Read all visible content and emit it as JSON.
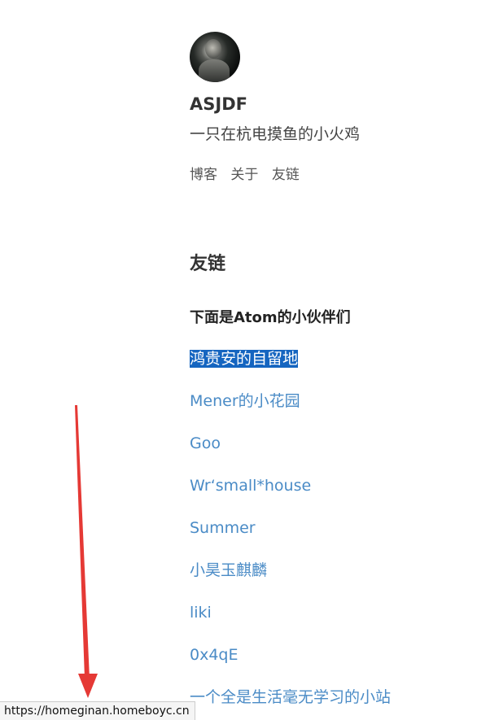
{
  "profile": {
    "name": "ASJDF",
    "tagline": "一只在杭电摸鱼的小火鸡"
  },
  "nav": {
    "items": [
      "博客",
      "关于",
      "友链"
    ]
  },
  "page": {
    "title": "友链",
    "intro": "下面是Atom的小伙伴们"
  },
  "links": [
    "鸿贵安的自留地",
    "Mener的小花园",
    "Goo",
    "Wr‘small*house",
    "Summer",
    "小昊玉麒麟",
    "liki",
    "0x4qE",
    "一个全是生活毫无学习的小站"
  ],
  "status_bar": {
    "url": "https://homeginan.homeboyc.cn"
  },
  "colors": {
    "link": "#4a8bc6",
    "selection": "#1565c0",
    "arrow": "#e53935"
  }
}
